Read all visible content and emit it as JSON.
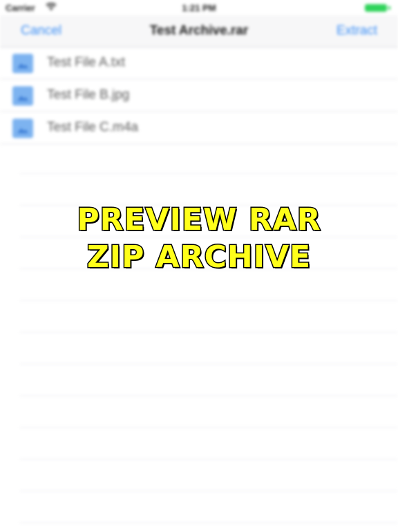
{
  "status_bar": {
    "carrier": "Carrier",
    "time": "1:21 PM",
    "wifi_icon": "wifi-icon",
    "battery_icon": "battery-icon",
    "battery_color": "#2fd35a"
  },
  "nav": {
    "cancel_label": "Cancel",
    "title": "Test Archive.rar",
    "extract_label": "Extract",
    "accent_color": "#3a8ef6"
  },
  "files": [
    {
      "name": "Test File A.txt",
      "icon": "image-file-icon"
    },
    {
      "name": "Test File B.jpg",
      "icon": "image-file-icon"
    },
    {
      "name": "Test File C.m4a",
      "icon": "image-file-icon"
    }
  ],
  "overlay": {
    "line1": "PREVIEW RAR",
    "line2": "ZIP ARCHIVE",
    "text_color": "#ffff1a"
  }
}
